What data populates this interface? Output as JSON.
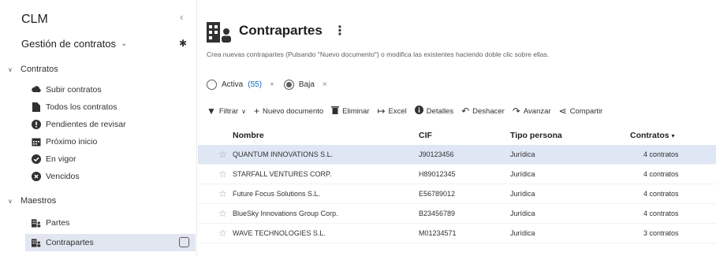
{
  "sidebar": {
    "app_title": "CLM",
    "collapse_glyph": "‹",
    "workspace": "Gestión de contratos",
    "sections": {
      "contratos": "Contratos",
      "maestros": "Maestros"
    },
    "items": [
      {
        "label": "Subir contratos",
        "icon": "upload-icon"
      },
      {
        "label": "Todos los contratos",
        "icon": "document-icon"
      },
      {
        "label": "Pendientes de revisar",
        "icon": "alert-icon"
      },
      {
        "label": "Próximo inicio",
        "icon": "calendar-icon"
      },
      {
        "label": "En vigor",
        "icon": "check-circle-icon"
      },
      {
        "label": "Vencidos",
        "icon": "x-circle-icon"
      },
      {
        "label": "Partes",
        "icon": "building-people-icon"
      },
      {
        "label": "Contrapartes",
        "icon": "building-people-icon"
      }
    ],
    "active_item": "Contrapartes"
  },
  "header": {
    "title": "Contrapartes",
    "more_glyph": "⋮",
    "description": "Crea nuevas contrapartes (Pulsando \"Nuevo documento\") o modifica las existentes haciendo doble clic sobre ellas."
  },
  "filters": {
    "activa_label": "Activa",
    "activa_count": "(55)",
    "baja_label": "Baja",
    "close_glyph": "×"
  },
  "toolbar": {
    "filtrar": "Filtrar",
    "nuevo": "Nuevo documento",
    "eliminar": "Eliminar",
    "excel": "Excel",
    "detalles": "Detalles",
    "deshacer": "Deshacer",
    "avanzar": "Avanzar",
    "compartir": "Compartir"
  },
  "grid": {
    "columns": {
      "nombre": "Nombre",
      "cif": "CIF",
      "tipo": "Tipo persona",
      "contratos": "Contratos"
    },
    "rows": [
      {
        "nombre": "QUANTUM INNOVATIONS S.L.",
        "cif": "J90123456",
        "tipo": "Jurídica",
        "contratos": "4 contratos"
      },
      {
        "nombre": "STARFALL VENTURES CORP.",
        "cif": "H89012345",
        "tipo": "Jurídica",
        "contratos": "4 contratos"
      },
      {
        "nombre": "Future Focus Solutions S.L.",
        "cif": "E56789012",
        "tipo": "Jurídica",
        "contratos": "4 contratos"
      },
      {
        "nombre": "BlueSky Innovations Group Corp.",
        "cif": "B23456789",
        "tipo": "Jurídica",
        "contratos": "4 contratos"
      },
      {
        "nombre": "WAVE TECHNOLOGIES S.L.",
        "cif": "M01234571",
        "tipo": "Jurídica",
        "contratos": "3 contratos"
      }
    ]
  },
  "colors": {
    "accent": "#0f6cbd",
    "selected_row": "#dfe7f5",
    "active_nav": "#e1e6f0"
  }
}
